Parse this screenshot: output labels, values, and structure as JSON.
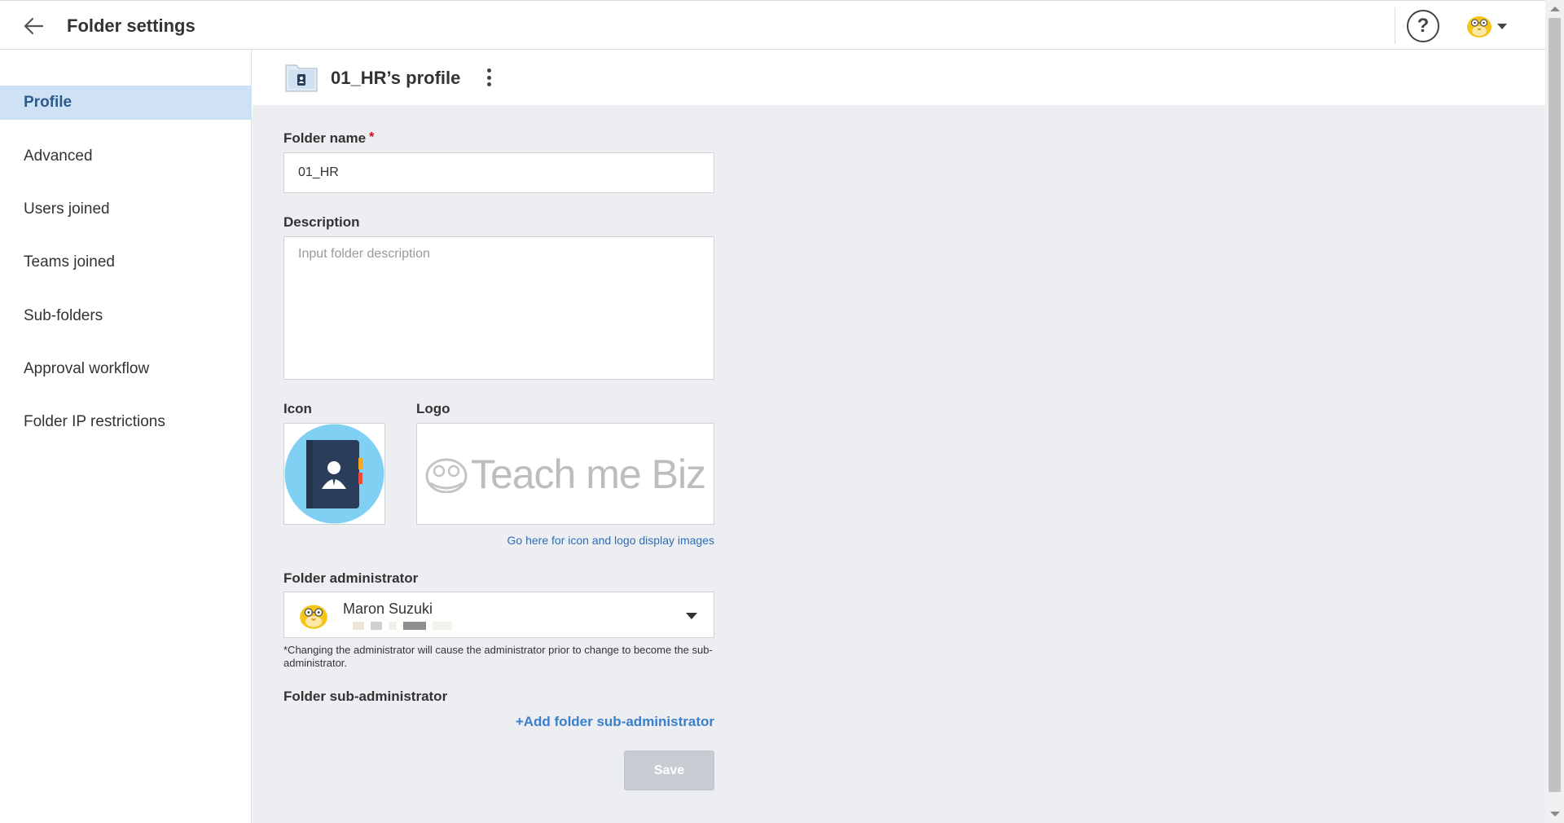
{
  "header": {
    "title": "Folder settings",
    "help_label": "?"
  },
  "sidebar": {
    "items": [
      {
        "label": "Profile",
        "active": true
      },
      {
        "label": "Advanced"
      },
      {
        "label": "Users joined"
      },
      {
        "label": "Teams joined"
      },
      {
        "label": "Sub-folders"
      },
      {
        "label": "Approval workflow"
      },
      {
        "label": "Folder IP restrictions"
      }
    ]
  },
  "content": {
    "folder_title": "01_HR’s profile",
    "folder_name": {
      "label": "Folder name",
      "required_mark": "*",
      "value": "01_HR"
    },
    "description": {
      "label": "Description",
      "placeholder": "Input folder description",
      "value": ""
    },
    "icon": {
      "label": "Icon"
    },
    "logo": {
      "label": "Logo",
      "text": "Teach me Biz"
    },
    "display_link": "Go here for icon and logo display images",
    "admin": {
      "label": "Folder administrator",
      "name": "Maron Suzuki",
      "note": "*Changing the administrator will cause the administrator prior to change to become the sub-administrator."
    },
    "sub_admin": {
      "label": "Folder sub-administrator",
      "add_link": "+Add folder sub-administrator"
    },
    "save_label": "Save"
  },
  "colors": {
    "accent": "#3a7fcb",
    "sidebar_active_bg": "#cfe1f5",
    "content_bg": "#eceef2",
    "required": "#d0021b",
    "icon_circle": "#7fd0f3",
    "avatar_yellow": "#f5c518"
  }
}
